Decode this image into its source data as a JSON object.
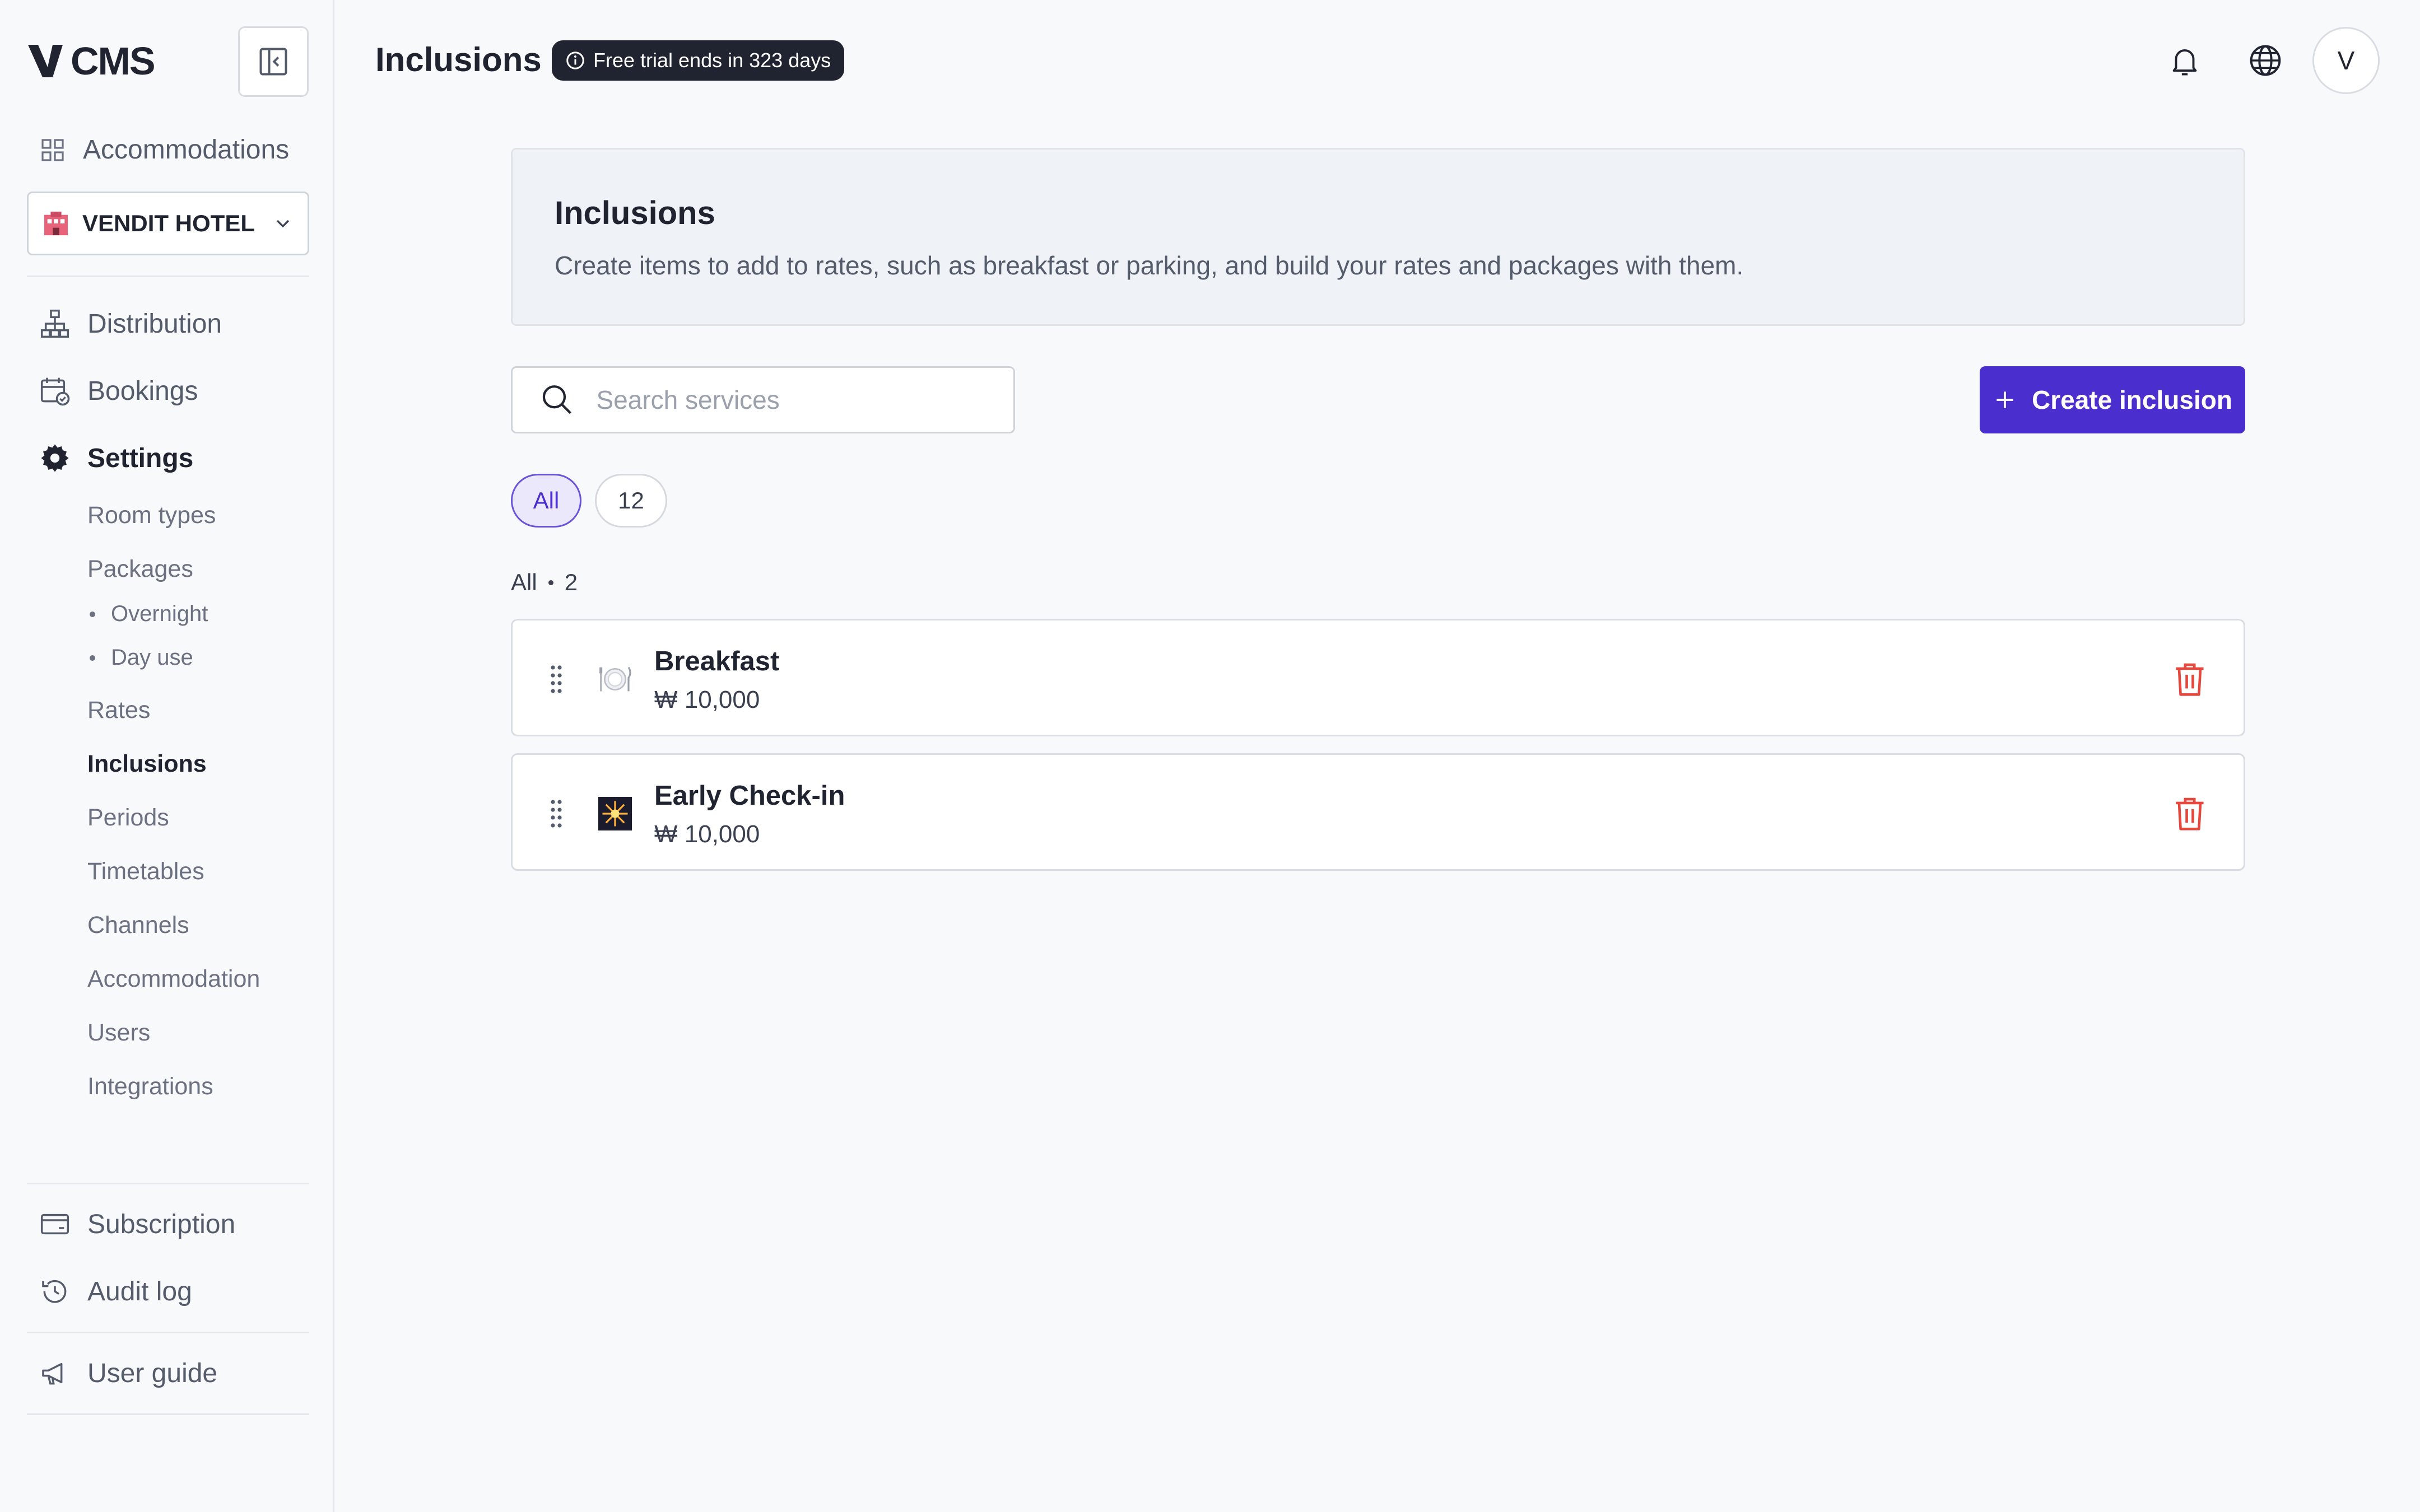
{
  "app": {
    "logo_text": "CMS"
  },
  "sidebar": {
    "accommodations_label": "Accommodations",
    "hotel_name": "VENDIT HOTEL",
    "hotel_icon": "hotel-building-icon",
    "nav": [
      {
        "label": "Distribution",
        "icon": "sitemap-icon"
      },
      {
        "label": "Bookings",
        "icon": "calendar-check-icon"
      },
      {
        "label": "Settings",
        "icon": "gear-icon"
      }
    ],
    "settings_items": {
      "room_types": "Room types",
      "packages": "Packages",
      "overnight": "Overnight",
      "day_use": "Day use",
      "rates": "Rates",
      "inclusions": "Inclusions",
      "periods": "Periods",
      "timetables": "Timetables",
      "channels": "Channels",
      "accommodation": "Accommodation",
      "users": "Users",
      "integrations": "Integrations"
    },
    "bottom": {
      "subscription": "Subscription",
      "audit_log": "Audit log",
      "user_guide": "User guide"
    }
  },
  "header": {
    "title": "Inclusions",
    "trial_badge": "Free trial ends in 323 days",
    "avatar_initial": "V"
  },
  "info_card": {
    "title": "Inclusions",
    "description": "Create items to add to rates, such as breakfast or parking, and build your rates and packages with them."
  },
  "toolbar": {
    "search_placeholder": "Search services",
    "search_value": "",
    "create_label": "Create inclusion"
  },
  "filters": {
    "chips": [
      "All",
      "12"
    ],
    "active": "All"
  },
  "list": {
    "group_label": "All",
    "group_count": "2",
    "items": [
      {
        "name": "Breakfast",
        "price": "₩ 10,000",
        "icon": "plate-cutlery-icon"
      },
      {
        "name": "Early Check-in",
        "price": "₩ 10,000",
        "icon": "fireworks-icon"
      }
    ]
  },
  "colors": {
    "accent": "#4a2fce",
    "danger": "#e5483d",
    "badge_bg": "#1f2430"
  }
}
